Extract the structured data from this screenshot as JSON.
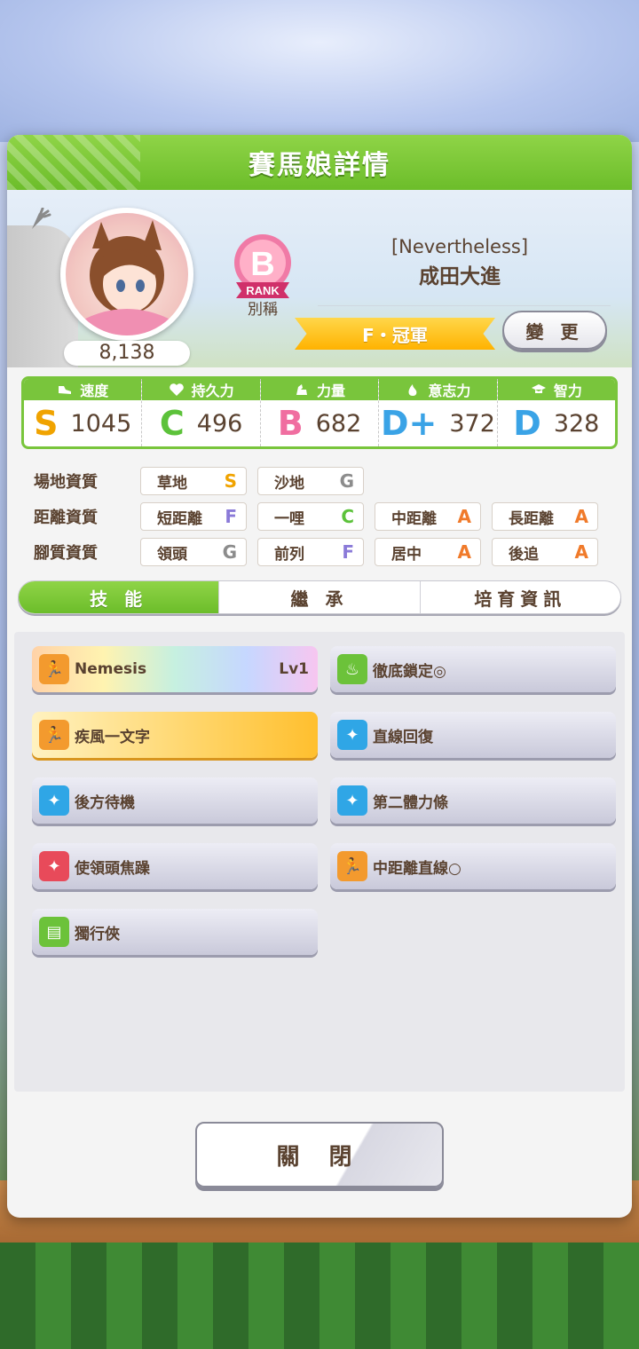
{
  "modal": {
    "title": "賽馬娘詳情"
  },
  "profile": {
    "fans": "8,138",
    "rank_letter": "B",
    "rank_word": "RANK",
    "alias_label": "別稱",
    "costume": "[Nevertheless]",
    "name": "成田大進",
    "epithet": "F・冠軍",
    "change_button": "變 更"
  },
  "stats": [
    {
      "label": "速度",
      "grade": "S",
      "grade_color": "#f0a300",
      "value": "1045",
      "icon": "shoe-icon"
    },
    {
      "label": "持久力",
      "grade": "C",
      "grade_color": "#5cc23a",
      "value": "496",
      "icon": "heart-icon"
    },
    {
      "label": "力量",
      "grade": "B",
      "grade_color": "#f06ea0",
      "value": "682",
      "icon": "muscle-icon"
    },
    {
      "label": "意志力",
      "grade": "D+",
      "grade_color": "#3aa3e6",
      "value": "372",
      "icon": "flame-icon"
    },
    {
      "label": "智力",
      "grade": "D",
      "grade_color": "#3aa3e6",
      "value": "328",
      "icon": "graduation-cap-icon"
    }
  ],
  "aptitudes": {
    "track": {
      "label": "場地資質",
      "items": [
        {
          "name": "草地",
          "grade": "S",
          "color": "#f0a300"
        },
        {
          "name": "沙地",
          "grade": "G",
          "color": "#8c8c8c"
        }
      ]
    },
    "distance": {
      "label": "距離資質",
      "items": [
        {
          "name": "短距離",
          "grade": "F",
          "color": "#8a7ad8"
        },
        {
          "name": "一哩",
          "grade": "C",
          "color": "#5cc23a"
        },
        {
          "name": "中距離",
          "grade": "A",
          "color": "#f07a2a"
        },
        {
          "name": "長距離",
          "grade": "A",
          "color": "#f07a2a"
        }
      ]
    },
    "style": {
      "label": "腳質資質",
      "items": [
        {
          "name": "領頭",
          "grade": "G",
          "color": "#8c8c8c"
        },
        {
          "name": "前列",
          "grade": "F",
          "color": "#8a7ad8"
        },
        {
          "name": "居中",
          "grade": "A",
          "color": "#f07a2a"
        },
        {
          "name": "後追",
          "grade": "A",
          "color": "#f07a2a"
        }
      ]
    }
  },
  "tabs": [
    {
      "label": "技 能",
      "active": true
    },
    {
      "label": "繼 承",
      "active": false
    },
    {
      "label": "培育資訊",
      "active": false
    }
  ],
  "skills": [
    {
      "name": "Nemesis",
      "level": "Lv1",
      "icon_color": "#f39a2e",
      "icon": "running-icon",
      "style": "unique"
    },
    {
      "name": "徹底鎖定◎",
      "level": "",
      "icon_color": "#6cc23a",
      "icon": "flame-icon",
      "style": "normal"
    },
    {
      "name": "疾風一文字",
      "level": "",
      "icon_color": "#f39a2e",
      "icon": "running-icon",
      "style": "gold"
    },
    {
      "name": "直線回復",
      "level": "",
      "icon_color": "#2fa6e6",
      "icon": "sparkle-icon",
      "style": "normal"
    },
    {
      "name": "後方待機",
      "level": "",
      "icon_color": "#2fa6e6",
      "icon": "sparkle-icon",
      "style": "normal"
    },
    {
      "name": "第二體力條",
      "level": "",
      "icon_color": "#2fa6e6",
      "icon": "sparkle-icon",
      "style": "normal"
    },
    {
      "name": "使領頭焦躁",
      "level": "",
      "icon_color": "#e84a5a",
      "icon": "sparkle-icon",
      "style": "normal"
    },
    {
      "name": "中距離直線○",
      "level": "",
      "icon_color": "#f39a2e",
      "icon": "running-icon",
      "style": "normal"
    },
    {
      "name": "獨行俠",
      "level": "",
      "icon_color": "#6cc23a",
      "icon": "card-icon",
      "style": "normal"
    }
  ],
  "close_button": "關 閉"
}
